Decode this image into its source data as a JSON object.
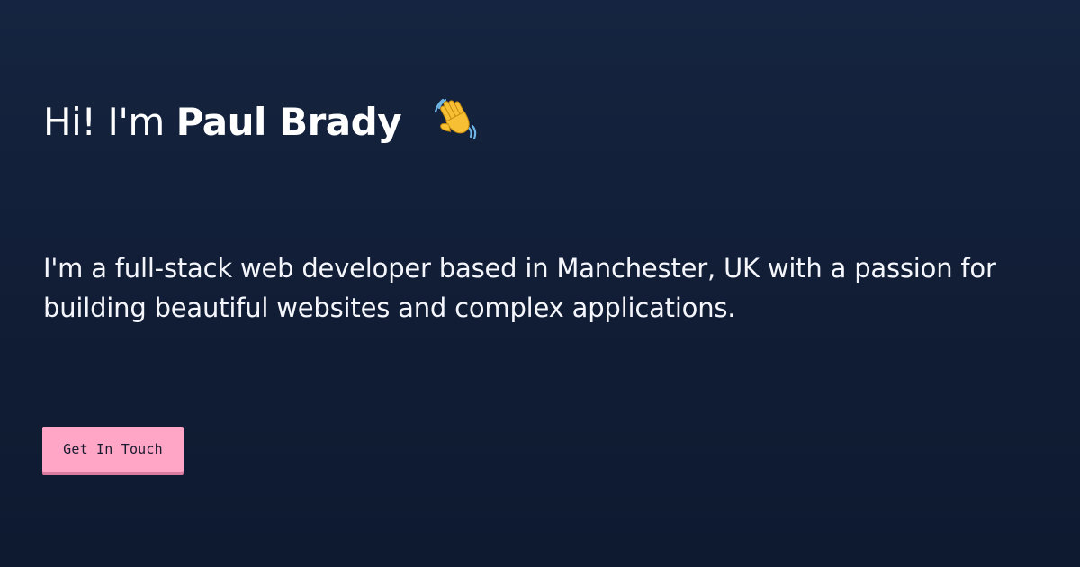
{
  "hero": {
    "greeting_prefix": "Hi! I'm",
    "name": "Paul Brady",
    "wave_icon": "waving-hand-icon",
    "intro": "I'm a full-stack web developer based in Manchester, UK with a passion for building beautiful websites and complex applications.",
    "cta_label": "Get In Touch"
  },
  "colors": {
    "background": "#132240",
    "text": "#ffffff",
    "button_bg": "#ffa5c6",
    "button_shadow": "#d97ba0",
    "button_text": "#1a1a2e"
  }
}
